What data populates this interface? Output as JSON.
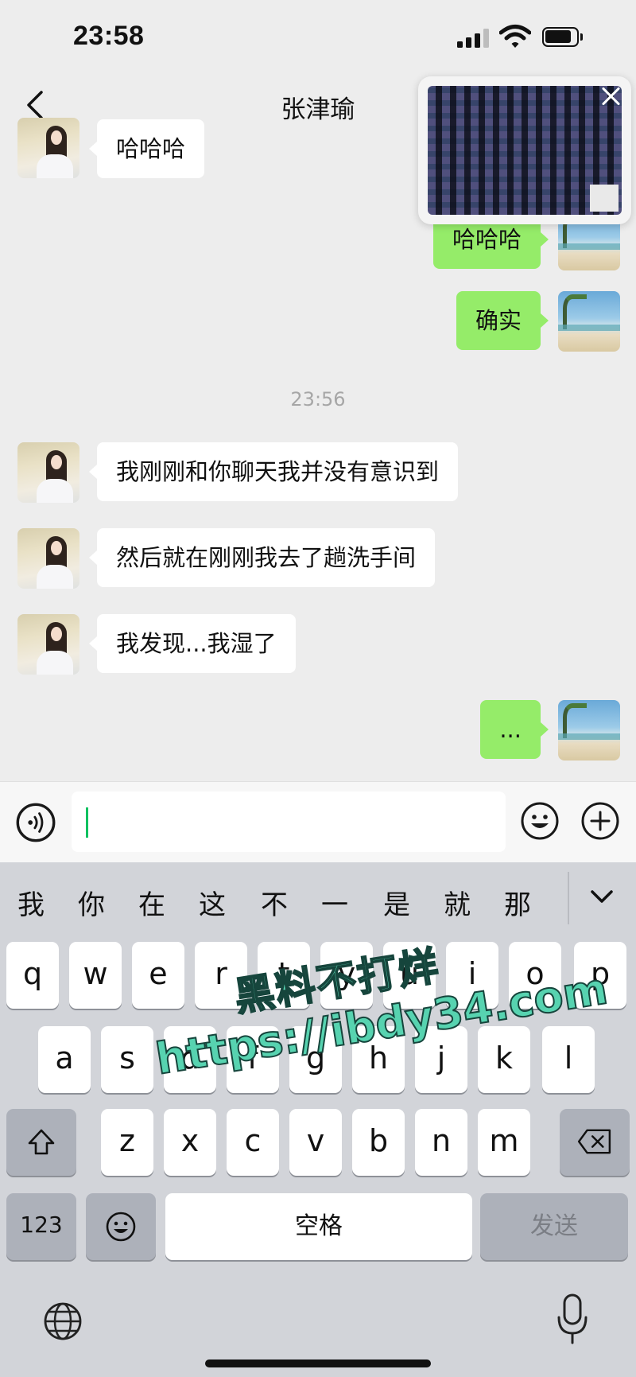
{
  "status_bar": {
    "time": "23:58"
  },
  "nav": {
    "title": "张津瑜"
  },
  "messages": [
    {
      "side": "in",
      "text": "哈哈哈"
    },
    {
      "side": "out",
      "text": "哈哈哈"
    },
    {
      "side": "out",
      "text": "确实"
    },
    {
      "side": "in",
      "text": "我刚刚和你聊天我并没有意识到"
    },
    {
      "side": "in",
      "text": "然后就在刚刚我去了趟洗手间"
    },
    {
      "side": "in",
      "text": "我发现...我湿了"
    },
    {
      "side": "out",
      "text": "..."
    }
  ],
  "timestamp": "23:56",
  "input": {
    "value": ""
  },
  "keyboard": {
    "candidates": [
      "我",
      "你",
      "在",
      "这",
      "不",
      "一",
      "是",
      "就",
      "那"
    ],
    "row1": [
      "q",
      "w",
      "e",
      "r",
      "t",
      "y",
      "u",
      "i",
      "o",
      "p"
    ],
    "row2": [
      "a",
      "s",
      "d",
      "f",
      "g",
      "h",
      "j",
      "k",
      "l"
    ],
    "row3": [
      "z",
      "x",
      "c",
      "v",
      "b",
      "n",
      "m"
    ],
    "numbers_label": "123",
    "space_label": "空格",
    "send_label": "发送"
  },
  "watermark": {
    "line1": "黑料不打烊",
    "line2": "https://ibdy34.com"
  },
  "colors": {
    "bubble_out": "#95ec69",
    "bubble_in": "#ffffff",
    "background": "#ededed",
    "cursor": "#07c160"
  }
}
